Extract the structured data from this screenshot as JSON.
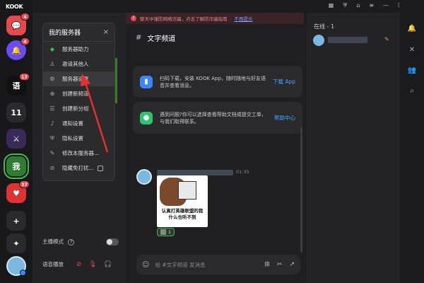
{
  "app": {
    "logo": "KOOK"
  },
  "rail": {
    "items": [
      {
        "name": "chat-server",
        "badge": "4",
        "color": "#e5484d",
        "glyph": "💬"
      },
      {
        "name": "bell-server",
        "badge": "4",
        "color": "#6a4cf0",
        "glyph": "🔔"
      },
      {
        "name": "server-3",
        "badge": "17",
        "color": "#111",
        "glyph": "语"
      },
      {
        "name": "server-11",
        "badge": "",
        "color": "#2a2a2d",
        "glyph": "11"
      },
      {
        "name": "server-5",
        "badge": "",
        "color": "#3a2a5a",
        "glyph": "⚔"
      },
      {
        "name": "server-me",
        "badge": "",
        "color": "#2f7d32",
        "glyph": "我"
      },
      {
        "name": "server-7",
        "badge": "37",
        "color": "#d33",
        "glyph": "♥"
      },
      {
        "name": "add-server",
        "badge": "",
        "color": "#2a2a2d",
        "glyph": "+"
      },
      {
        "name": "discover",
        "badge": "",
        "color": "#2a2a2d",
        "glyph": "✦"
      }
    ]
  },
  "server_menu": {
    "title": "我的服务器",
    "close": "×",
    "items": [
      {
        "label": "服务器助力",
        "icon": "◆"
      },
      {
        "label": "邀请其他人",
        "icon": "♙"
      },
      {
        "label": "服务器设置",
        "icon": "⚙"
      },
      {
        "label": "创建新频道",
        "icon": "⊕"
      },
      {
        "label": "创建新分组",
        "icon": "☰"
      },
      {
        "label": "通知设置",
        "icon": "♪"
      },
      {
        "label": "隐私设置",
        "icon": "⛨"
      },
      {
        "label": "修改本服务器...",
        "icon": "✎"
      },
      {
        "label": "隐藏免打扰...",
        "icon": "⊘"
      }
    ]
  },
  "channel_panel": {
    "host_mode_label": "主播模式",
    "host_mode_help": "?",
    "voice_label": "语音播放"
  },
  "banner": {
    "text": "聊天中谨防网络诈骗，点击了解防诈骗指南",
    "action": "不再提示",
    "icon": "!"
  },
  "chat": {
    "channel_hash": "#",
    "channel_name": "文字频道",
    "cards": [
      {
        "text": "扫码下载，安装 KOOK App，随时随地与好友语音并查看消息。",
        "action": "下载 App",
        "icon_color": "#3a86ff",
        "icon": "▮"
      },
      {
        "text": "遇到问题?你可以选择查看帮助文档或提交工单，与我们取得联系。",
        "action": "帮助中心",
        "icon_color": "#2ec46c",
        "icon": "●"
      }
    ],
    "message_time": "01:35",
    "sticker_caption_line1": "认真打英雄联盟的我",
    "sticker_caption_line2": "什么也听不到",
    "reaction_count": "1",
    "composer_placeholder": "给 #文字频道 发消息"
  },
  "members": {
    "online_label": "在线 - 1"
  },
  "right_tools": [
    "bell-icon",
    "pin-icon",
    "members-icon",
    "search-icon"
  ],
  "colors": {
    "accent": "#3fb950",
    "alert": "#e5484d",
    "link": "#4aa3ff"
  }
}
